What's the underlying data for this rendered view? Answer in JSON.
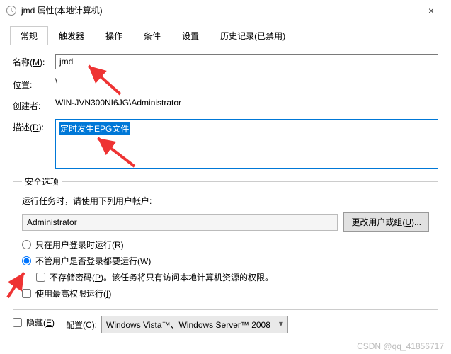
{
  "window": {
    "title": "jmd 属性(本地计算机)"
  },
  "tabs": [
    "常规",
    "触发器",
    "操作",
    "条件",
    "设置",
    "历史记录(已禁用)"
  ],
  "fields": {
    "name_label": "名称(M):",
    "name_value": "jmd",
    "location_label": "位置:",
    "location_value": "\\",
    "creator_label": "创建者:",
    "creator_value": "WIN-JVN300NI6JG\\Administrator",
    "desc_label": "描述(D):",
    "desc_value": "定时发生EPG文件"
  },
  "security": {
    "legend": "安全选项",
    "run_as_label": "运行任务时，请使用下列用户帐户:",
    "user": "Administrator",
    "change_user_btn": "更改用户或组(U)...",
    "radio1": "只在用户登录时运行(R)",
    "radio2": "不管用户是否登录都要运行(W)",
    "no_store_pwd": "不存储密码(P)。该任务将只有访问本地计算机资源的权限。",
    "highest_priv": "使用最高权限运行(I)"
  },
  "footer": {
    "hidden_label": "隐藏(E)",
    "config_label": "配置(C):",
    "config_value": "Windows Vista™、Windows Server™ 2008"
  },
  "watermark": "CSDN @qq_41856717"
}
